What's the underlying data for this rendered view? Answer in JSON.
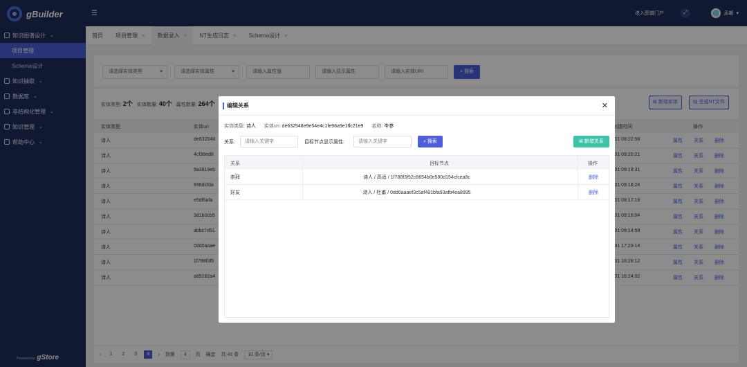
{
  "app": {
    "logo": "gBuilder",
    "powered_by": "Powered by",
    "powered_brand": "gStore"
  },
  "sidebar": {
    "items": [
      {
        "label": "知识图谱设计",
        "icon": "gear-icon",
        "type": "group"
      },
      {
        "label": "项目管理",
        "type": "sub",
        "active": true
      },
      {
        "label": "Schema设计",
        "type": "sub"
      },
      {
        "label": "知识抽取",
        "icon": "share-icon",
        "type": "group"
      },
      {
        "label": "数据库",
        "icon": "database-icon",
        "type": "group"
      },
      {
        "label": "非结构化管理",
        "icon": "gear-icon",
        "type": "group"
      },
      {
        "label": "知识管理",
        "icon": "book-icon",
        "type": "group"
      },
      {
        "label": "帮助中心",
        "icon": "help-icon",
        "type": "group"
      }
    ]
  },
  "topbar": {
    "portal": "进入图谱门户",
    "user": "孟朝",
    "collapse_icon": "menu-fold-icon"
  },
  "tabs": [
    {
      "label": "首页",
      "closable": false
    },
    {
      "label": "项目管理",
      "closable": true
    },
    {
      "label": "数据录入",
      "closable": true,
      "selected": true
    },
    {
      "label": "NT生成日志",
      "closable": true
    },
    {
      "label": "Schema设计",
      "closable": true
    }
  ],
  "filters": {
    "entity_type": "请选择实体类型",
    "entity_attr": "请选择实体属性",
    "attr_value": "请输入属性值",
    "display_attr": "请输入显示属性",
    "entity_uri": "请输入实体URI",
    "search": "搜索"
  },
  "stats": {
    "type_label": "实体类型:",
    "type_count": "2个",
    "count_label": "实体数量:",
    "count_value": "40个",
    "attr_label": "属性数量:",
    "attr_value": "264个"
  },
  "buttons": {
    "new_entity": "新增实体",
    "gen_nt": "生成NT文件"
  },
  "table": {
    "headers": {
      "type": "实体类型",
      "uri": "实体uri",
      "time": "创建时间",
      "ops": "操作"
    },
    "rows": [
      {
        "type": "诗人",
        "uri": "de632548",
        "time": "-01 09:22:58"
      },
      {
        "type": "诗人",
        "uri": "4cf38ed8",
        "time": "-01 09:20:21"
      },
      {
        "type": "诗人",
        "uri": "9a3819eb",
        "time": "-01 09:19:31"
      },
      {
        "type": "诗人",
        "uri": "938dcfda",
        "time": "-01 09:18:24"
      },
      {
        "type": "诗人",
        "uri": "e5df6afa",
        "time": "-01 09:17:19"
      },
      {
        "type": "诗人",
        "uri": "3d1b0cb5",
        "time": "-01 09:16:04"
      },
      {
        "type": "诗人",
        "uri": "abbc7d51",
        "time": "-01 09:14:58"
      },
      {
        "type": "诗人",
        "uri": "0dd0aaae",
        "time": "-31 17:23:14"
      },
      {
        "type": "诗人",
        "uri": "1f788f3f5",
        "time": "-31 16:28:12"
      },
      {
        "type": "诗人",
        "uri": "a85282a4",
        "time": "-31 16:24:02"
      }
    ],
    "ops": [
      "属性",
      "关系",
      "删除"
    ]
  },
  "pagination": {
    "pages": [
      "1",
      "2",
      "3",
      "4"
    ],
    "current": "4",
    "goto": "到第",
    "page_input": "4",
    "page_unit": "页",
    "confirm": "确定",
    "total": "共 40 条",
    "per_page": "10 条/页"
  },
  "modal": {
    "title": "编辑关系",
    "type_label": "实体类型:",
    "type_value": "诗人",
    "uri_label": "实体uri:",
    "uri_value": "de632548e9e54e4c1fe98a9e1ffc21e9",
    "name_label": "名称:",
    "name_value": "岑参",
    "rel_label": "关系:",
    "rel_placeholder": "请输入关键字",
    "target_label": "目标节点显示属性:",
    "target_placeholder": "请输入关键字",
    "search": "搜索",
    "add": "新增关系",
    "headers": {
      "relation": "关系",
      "target": "目标节点",
      "ops": "操作"
    },
    "rows": [
      {
        "relation": "崇拜",
        "target": "诗人 / 高适 / 1f788f3f52c8654b0e580d154cfcea8c",
        "op": "删除"
      },
      {
        "relation": "好友",
        "target": "诗人 / 杜甫 / 0dd0aaaef3c5af481bfa93afb4ea8995",
        "op": "删除"
      }
    ]
  }
}
